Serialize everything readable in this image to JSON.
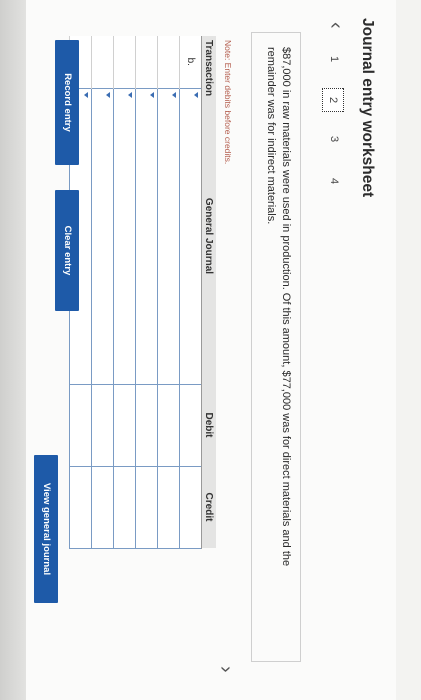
{
  "title": "Journal entry worksheet",
  "steps": [
    "1",
    "2",
    "3",
    "4"
  ],
  "active_step": "2",
  "problem_text": "$87,000 in raw materials were used in production. Of this amount, $77,000 was for direct materials and the remainder was for indirect materials.",
  "note": "Note: Enter debits before credits.",
  "table": {
    "headers": {
      "transaction": "Transaction",
      "general_journal": "General Journal",
      "debit": "Debit",
      "credit": "Credit"
    },
    "first_transaction": "b.",
    "row_count": 6
  },
  "buttons": {
    "record": "Record entry",
    "clear": "Clear entry",
    "view": "View general journal"
  },
  "icons": {
    "prev": "chevron-left-icon",
    "next": "chevron-right-icon",
    "dropdown": "dropdown-arrow-icon"
  },
  "colors": {
    "button": "#1e5aa8",
    "note": "#b25a4a",
    "cell_border": "#7a9bc4"
  }
}
